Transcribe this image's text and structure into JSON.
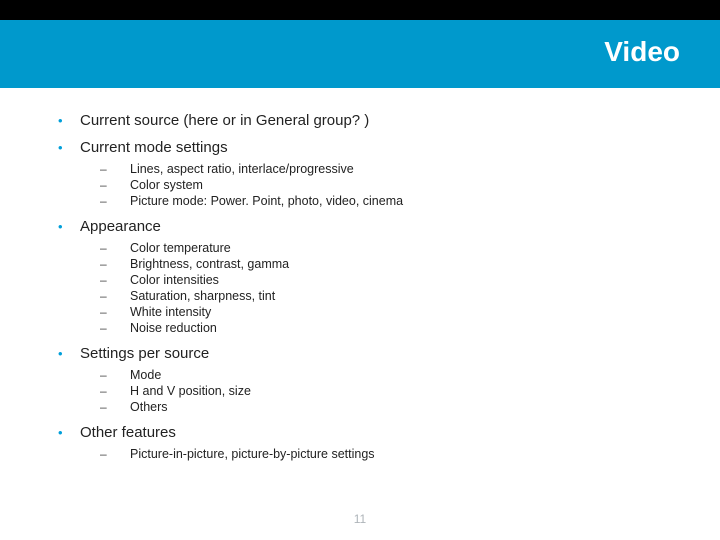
{
  "header": {
    "title": "Video"
  },
  "items": [
    {
      "text": "Current source (here or in General group? )",
      "sub": []
    },
    {
      "text": "Current mode settings",
      "sub": [
        "Lines, aspect ratio, interlace/progressive",
        "Color system",
        "Picture mode: Power. Point, photo, video, cinema"
      ]
    },
    {
      "text": "Appearance",
      "sub": [
        "Color temperature",
        "Brightness, contrast, gamma",
        "Color intensities",
        "Saturation, sharpness, tint",
        "White intensity",
        "Noise reduction"
      ]
    },
    {
      "text": "Settings per source",
      "sub": [
        "Mode",
        "H and V position, size",
        "Others"
      ]
    },
    {
      "text": "Other features",
      "sub": [
        "Picture-in-picture, picture-by-picture settings"
      ]
    }
  ],
  "page_number": "11"
}
